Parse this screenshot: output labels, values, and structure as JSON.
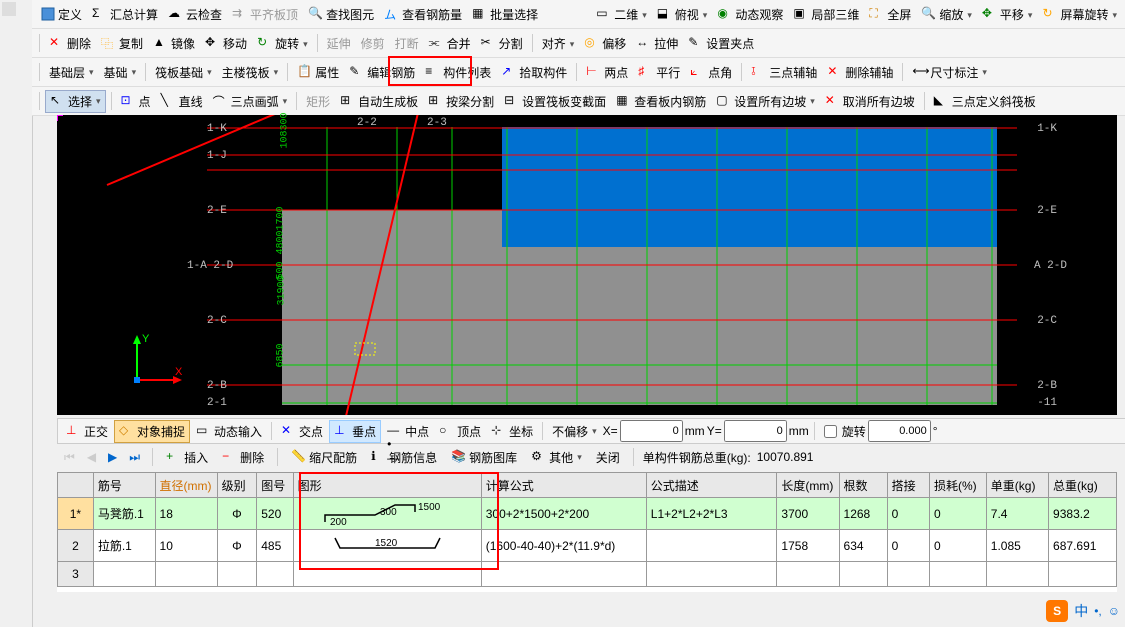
{
  "toolbar1": {
    "define": "定义",
    "sum_calc": "汇总计算",
    "cloud_check": "云检查",
    "level_top": "平齐板顶",
    "find_element": "查找图元",
    "view_rebar": "查看钢筋量",
    "batch_select": "批量选择",
    "two_d": "二维",
    "overlook": "俯视",
    "dynamic_view": "动态观察",
    "local_3d": "局部三维",
    "fullscreen": "全屏",
    "zoom": "缩放",
    "pan": "平移",
    "screen_rotate": "屏幕旋转"
  },
  "toolbar2": {
    "delete": "删除",
    "copy": "复制",
    "mirror": "镜像",
    "move": "移动",
    "rotate": "旋转",
    "extend": "延伸",
    "trim": "修剪",
    "break": "打断",
    "merge": "合并",
    "split": "分割",
    "align": "对齐",
    "offset": "偏移",
    "stretch": "拉伸",
    "set_grip": "设置夹点"
  },
  "toolbar3": {
    "floor": "基础层",
    "basis": "基础",
    "raft_base": "筏板基础",
    "main_raft": "主楼筏板",
    "property": "属性",
    "edit_rebar": "编辑钢筋",
    "component_list": "构件列表",
    "pick_component": "拾取构件",
    "two_point": "两点",
    "parallel": "平行",
    "point_angle": "点角",
    "three_point_axis": "三点辅轴",
    "delete_axis": "删除辅轴",
    "dim_label": "尺寸标注"
  },
  "toolbar4": {
    "select": "选择",
    "point": "点",
    "line": "直线",
    "three_point_arc": "三点画弧",
    "rectangle": "矩形",
    "auto_gen_slab": "自动生成板",
    "by_beam_split": "按梁分割",
    "set_raft_section": "设置筏板变截面",
    "view_slab_rebar": "查看板内钢筋",
    "set_all_edges": "设置所有边坡",
    "cancel_all_slope": "取消所有边坡",
    "three_point_slant": "三点定义斜筏板"
  },
  "status": {
    "ortho": "正交",
    "osnap": "对象捕捉",
    "dynamic_input": "动态输入",
    "intersection": "交点",
    "perpendicular": "垂点",
    "midpoint": "中点",
    "vertex": "顶点",
    "coord": "坐标",
    "no_offset": "不偏移",
    "x_label": "X=",
    "x_val": "0",
    "y_label": "Y=",
    "y_val": "0",
    "mm": "mm",
    "rotate": "旋转",
    "angle": "0.000",
    "deg": "°"
  },
  "rebar_bar": {
    "insert": "插入",
    "delete": "删除",
    "scale_rebar": "缩尺配筋",
    "rebar_info": "钢筋信息",
    "rebar_lib": "钢筋图库",
    "other": "其他",
    "close": "关闭",
    "total_label": "单构件钢筋总重(kg):",
    "total_value": "10070.891"
  },
  "table": {
    "headers": [
      "",
      "筋号",
      "直径(mm)",
      "级别",
      "图号",
      "图形",
      "计算公式",
      "公式描述",
      "长度(mm)",
      "根数",
      "搭接",
      "损耗(%)",
      "单重(kg)",
      "总重(kg)"
    ],
    "rows": [
      {
        "idx": "1*",
        "name": "马凳筋.1",
        "dia": "18",
        "grade": "Φ",
        "fig": "520",
        "shape_dims": [
          "300",
          "1500",
          "200"
        ],
        "formula": "300+2*1500+2*200",
        "desc": "L1+2*L2+2*L3",
        "len": "3700",
        "qty": "1268",
        "lap": "0",
        "loss": "0",
        "unit_w": "7.4",
        "total_w": "9383.2"
      },
      {
        "idx": "2",
        "name": "拉筋.1",
        "dia": "10",
        "grade": "Φ",
        "fig": "485",
        "shape_dims": [
          "1520"
        ],
        "formula": "(1600-40-40)+2*(11.9*d)",
        "desc": "",
        "len": "1758",
        "qty": "634",
        "lap": "0",
        "loss": "0",
        "unit_w": "1.085",
        "total_w": "687.691"
      },
      {
        "idx": "3",
        "name": "",
        "dia": "",
        "grade": "",
        "fig": "",
        "shape_dims": [],
        "formula": "",
        "desc": "",
        "len": "",
        "qty": "",
        "lap": "",
        "loss": "",
        "unit_w": "",
        "total_w": ""
      }
    ]
  },
  "grid_labels": {
    "left": [
      "1-K",
      "1-J",
      "2-E",
      "1-A 2-D",
      "2-C",
      "2-B",
      "2-1"
    ],
    "right": [
      "1-K",
      "2-E",
      "A 2-D",
      "2-C",
      "2-B",
      "-11"
    ],
    "top": [
      "2-2",
      "2-3"
    ],
    "dims_left": [
      "108300",
      "48001700",
      "31900",
      "500",
      "6850"
    ]
  },
  "ime": {
    "label": "中"
  }
}
